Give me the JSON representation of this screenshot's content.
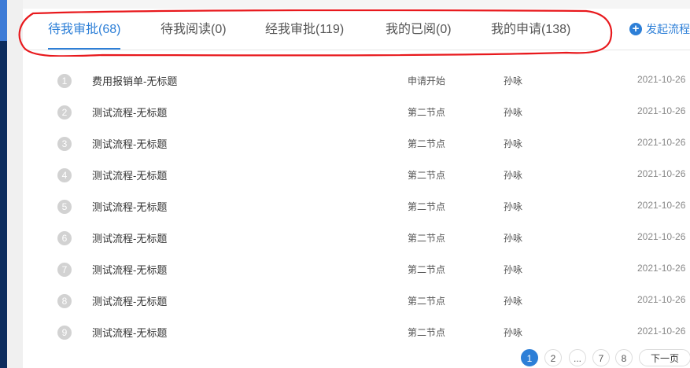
{
  "tabs": [
    {
      "label": "待我审批(68)"
    },
    {
      "label": "待我阅读(0)"
    },
    {
      "label": "经我审批(119)"
    },
    {
      "label": "我的已阅(0)"
    },
    {
      "label": "我的申请(138)"
    }
  ],
  "active_tab": 0,
  "new_flow_label": "发起流程",
  "rows": [
    {
      "num": "1",
      "title": "费用报销单-无标题",
      "node": "申请开始",
      "user": "孙咏",
      "date": "2021-10-26"
    },
    {
      "num": "2",
      "title": "测试流程-无标题",
      "node": "第二节点",
      "user": "孙咏",
      "date": "2021-10-26"
    },
    {
      "num": "3",
      "title": "测试流程-无标题",
      "node": "第二节点",
      "user": "孙咏",
      "date": "2021-10-26"
    },
    {
      "num": "4",
      "title": "测试流程-无标题",
      "node": "第二节点",
      "user": "孙咏",
      "date": "2021-10-26"
    },
    {
      "num": "5",
      "title": "测试流程-无标题",
      "node": "第二节点",
      "user": "孙咏",
      "date": "2021-10-26"
    },
    {
      "num": "6",
      "title": "测试流程-无标题",
      "node": "第二节点",
      "user": "孙咏",
      "date": "2021-10-26"
    },
    {
      "num": "7",
      "title": "测试流程-无标题",
      "node": "第二节点",
      "user": "孙咏",
      "date": "2021-10-26"
    },
    {
      "num": "8",
      "title": "测试流程-无标题",
      "node": "第二节点",
      "user": "孙咏",
      "date": "2021-10-26"
    },
    {
      "num": "9",
      "title": "测试流程-无标题",
      "node": "第二节点",
      "user": "孙咏",
      "date": "2021-10-26"
    }
  ],
  "pagination": {
    "pages": [
      "1",
      "2",
      "...",
      "7",
      "8"
    ],
    "current": "1",
    "next_label": "下一页"
  },
  "colors": {
    "accent": "#2d7fd7",
    "annotation": "#e8191d",
    "sidebar": "#0d2d5e"
  }
}
